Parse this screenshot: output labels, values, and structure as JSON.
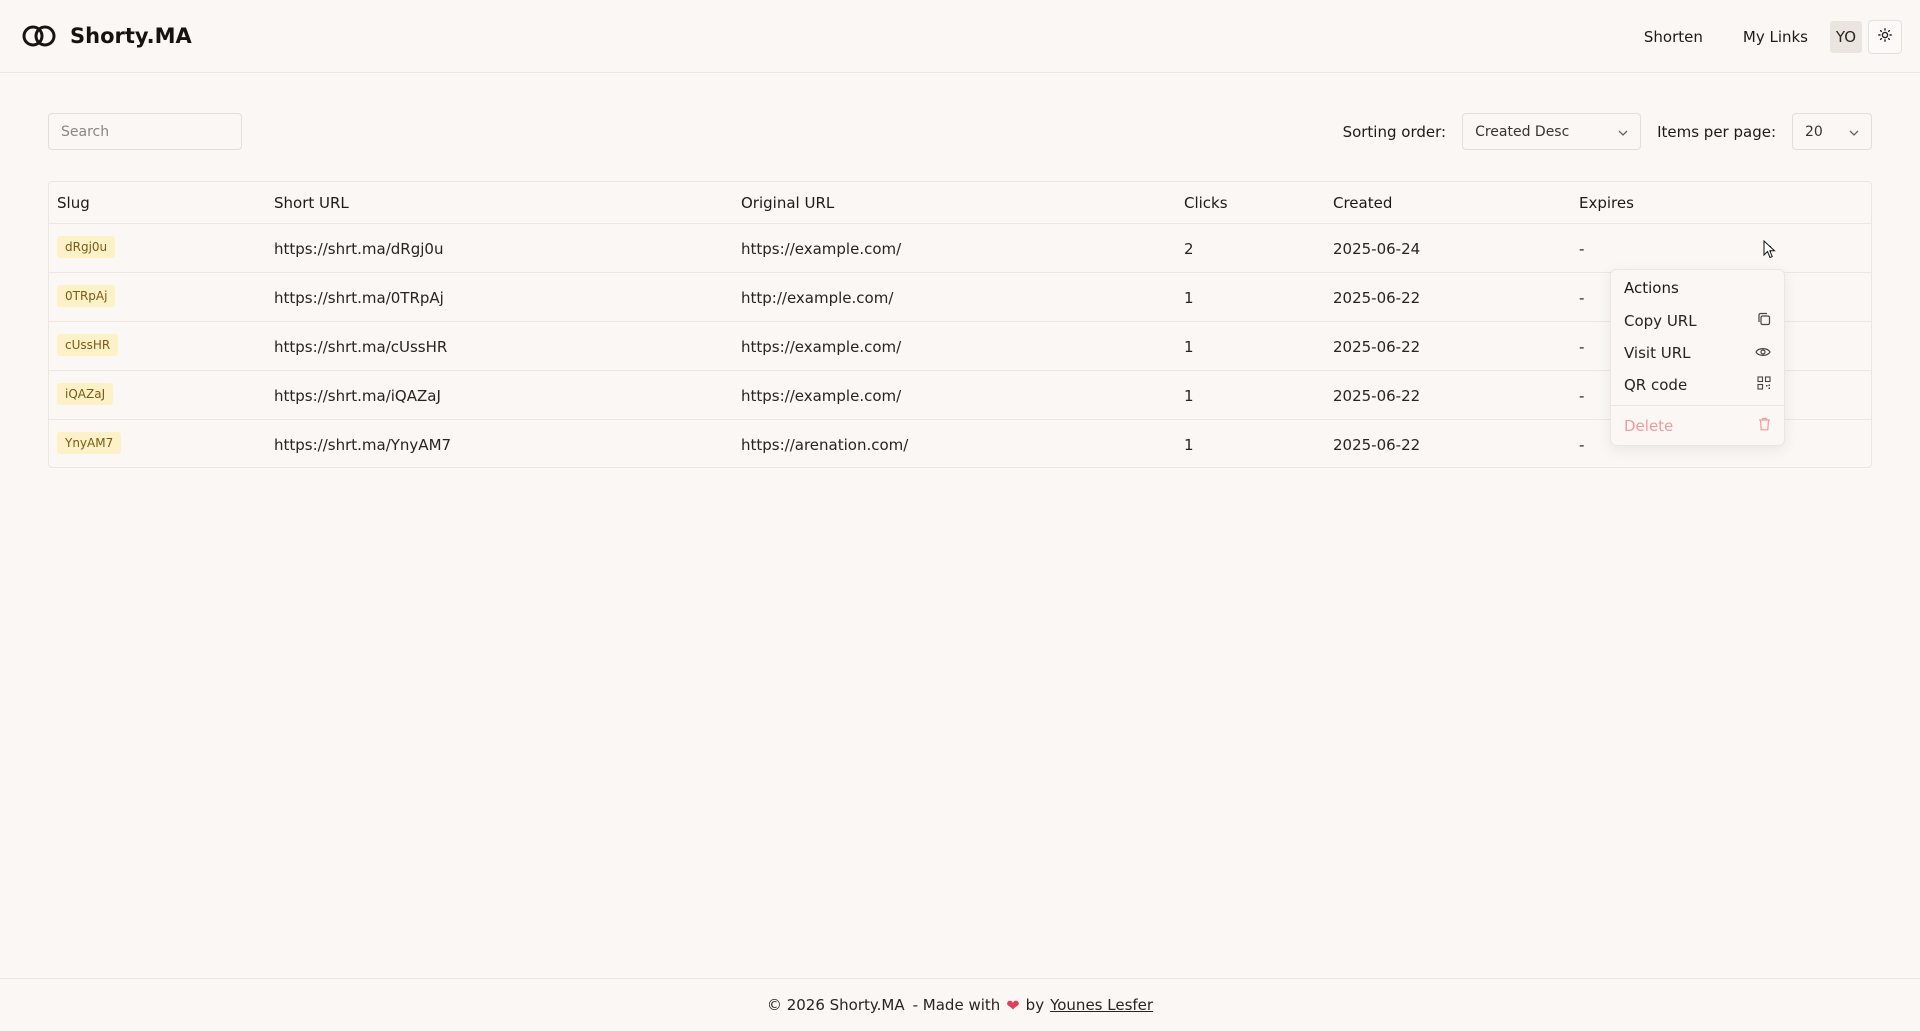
{
  "brand": {
    "name": "Shorty.MA",
    "logo_icon": "linked-rings-icon"
  },
  "nav": {
    "shorten": "Shorten",
    "my_links": "My Links",
    "avatar": "YO",
    "theme_icon": "sun-icon"
  },
  "toolbar": {
    "search_placeholder": "Search",
    "sort_label": "Sorting order:",
    "sort_value": "Created Desc",
    "ipp_label": "Items per page:",
    "ipp_value": "20"
  },
  "table": {
    "headers": {
      "slug": "Slug",
      "short_url": "Short URL",
      "original_url": "Original URL",
      "clicks": "Clicks",
      "created": "Created",
      "expires": "Expires"
    },
    "rows": [
      {
        "slug": "dRgj0u",
        "short_url": "https://shrt.ma/dRgj0u",
        "original_url": "https://example.com/",
        "clicks": "2",
        "created": "2025-06-24",
        "expires": "-"
      },
      {
        "slug": "0TRpAj",
        "short_url": "https://shrt.ma/0TRpAj",
        "original_url": "http://example.com/",
        "clicks": "1",
        "created": "2025-06-22",
        "expires": "-"
      },
      {
        "slug": "cUssHR",
        "short_url": "https://shrt.ma/cUssHR",
        "original_url": "https://example.com/",
        "clicks": "1",
        "created": "2025-06-22",
        "expires": "-"
      },
      {
        "slug": "iQAZaJ",
        "short_url": "https://shrt.ma/iQAZaJ",
        "original_url": "https://example.com/",
        "clicks": "1",
        "created": "2025-06-22",
        "expires": "-"
      },
      {
        "slug": "YnyAM7",
        "short_url": "https://shrt.ma/YnyAM7",
        "original_url": "https://arenation.com/",
        "clicks": "1",
        "created": "2025-06-22",
        "expires": "-"
      }
    ]
  },
  "menu": {
    "title": "Actions",
    "copy": "Copy URL",
    "visit": "Visit URL",
    "qr": "QR code",
    "delete": "Delete"
  },
  "footer": {
    "copyright": "© 2026 Shorty.MA",
    "made_with": "- Made with",
    "by": "by",
    "author": "Younes Lesfer"
  },
  "colors": {
    "background": "#faf7f4",
    "slug_badge_bg": "#fdf1c7",
    "slug_badge_text": "#7a5a16",
    "danger": "#f29a9a",
    "heart": "#e0405a"
  }
}
